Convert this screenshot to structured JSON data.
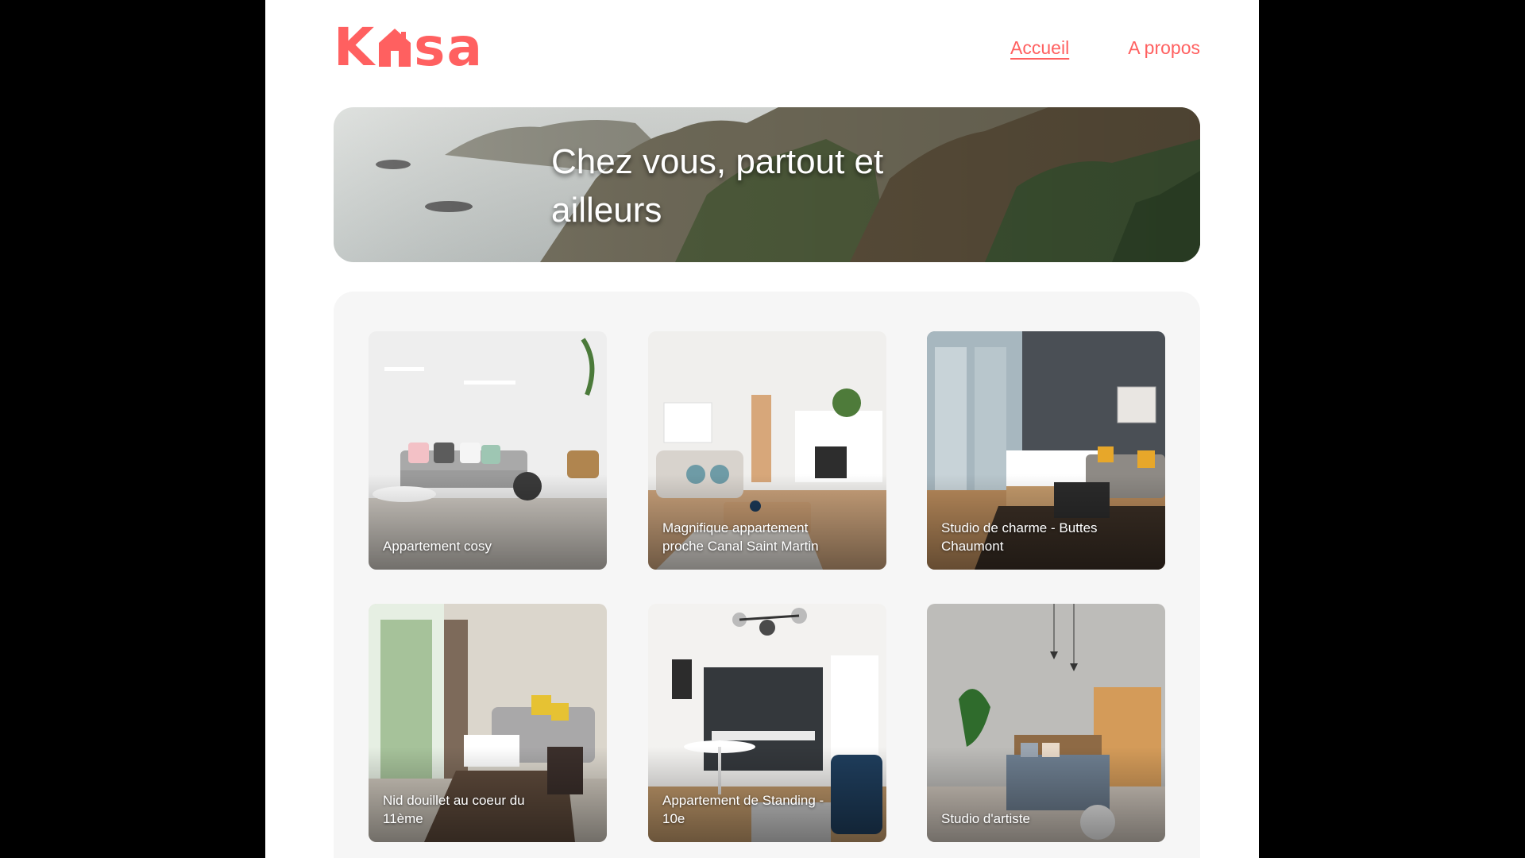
{
  "header": {
    "logo": {
      "text": "Kasa"
    },
    "nav": [
      {
        "label": "Accueil",
        "active": true
      },
      {
        "label": "A propos",
        "active": false
      }
    ]
  },
  "banner": {
    "title": "Chez vous, partout et ailleurs"
  },
  "listings": [
    {
      "title": "Appartement cosy"
    },
    {
      "title": "Magnifique appartement proche Canal Saint Martin"
    },
    {
      "title": "Studio de charme - Buttes Chaumont"
    },
    {
      "title": "Nid douillet au coeur du 11ème"
    },
    {
      "title": "Appartement de Standing - 10e"
    },
    {
      "title": "Studio d'artiste"
    }
  ],
  "colors": {
    "brand": "#FF6060",
    "gallery_bg": "#F6F6F6"
  }
}
